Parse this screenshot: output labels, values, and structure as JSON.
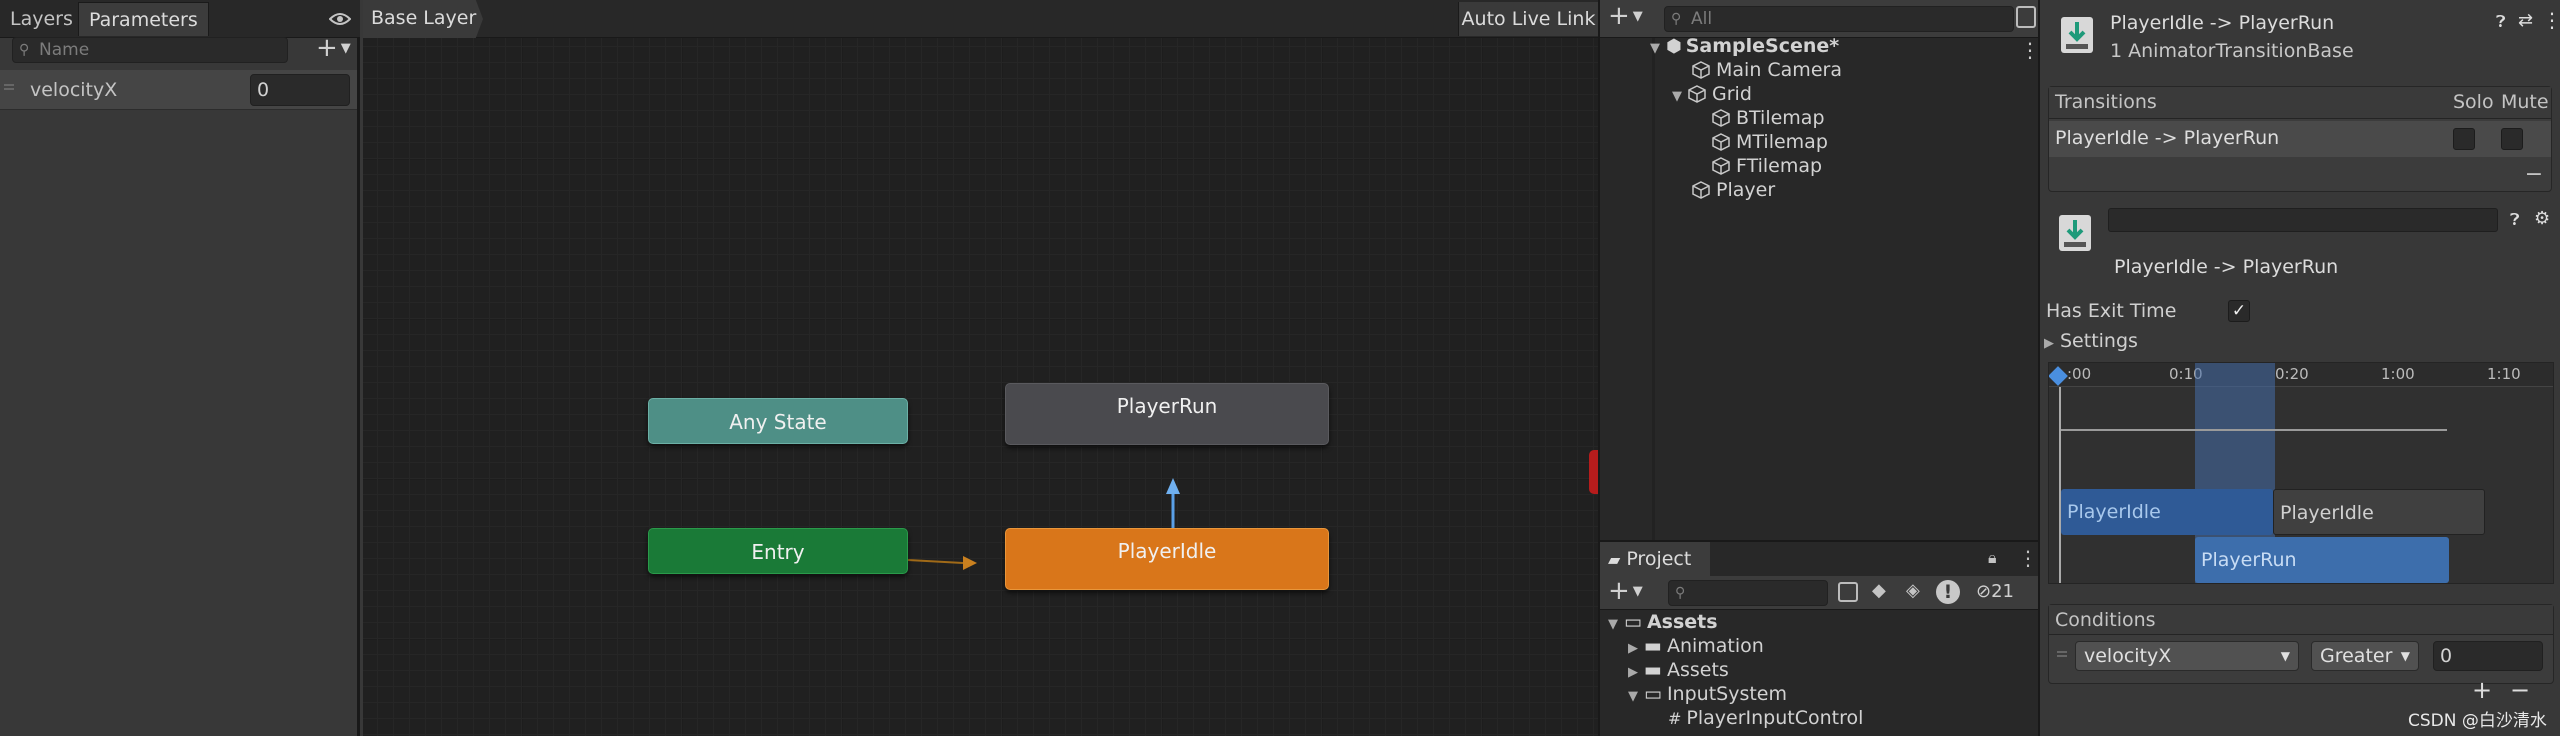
{
  "params": {
    "tabs": [
      "Layers",
      "Parameters"
    ],
    "search_placeholder": "Name",
    "add": "+",
    "items": [
      {
        "name": "velocityX",
        "value": "0"
      }
    ]
  },
  "graph": {
    "breadcrumb": "Base Layer",
    "auto_live_link": "Auto Live Link",
    "nodes": {
      "any_state": "Any State",
      "entry": "Entry",
      "player_run": "PlayerRun",
      "player_idle": "PlayerIdle"
    },
    "colors": {
      "any_state": "#4e8f86",
      "entry": "#1a7a37",
      "idle": "#d9761a",
      "run": "#4a4a4e"
    }
  },
  "hierarchy": {
    "search_placeholder": "All",
    "scene": "SampleScene*",
    "items": [
      {
        "label": "Main Camera"
      },
      {
        "label": "Grid"
      },
      {
        "label": "BTilemap"
      },
      {
        "label": "MTilemap"
      },
      {
        "label": "FTilemap"
      },
      {
        "label": "Player"
      }
    ]
  },
  "project": {
    "title": "Project",
    "hidden_count": "21",
    "tree": [
      {
        "label": "Assets"
      },
      {
        "label": "Animation"
      },
      {
        "label": "Assets"
      },
      {
        "label": "InputSystem"
      },
      {
        "label": "PlayerInputControl"
      }
    ]
  },
  "inspector": {
    "title": "PlayerIdle -> PlayerRun",
    "subtitle": "1 AnimatorTransitionBase",
    "transitions_header": "Transitions",
    "solo": "Solo",
    "mute": "Mute",
    "transition_row": "PlayerIdle -> PlayerRun",
    "minus": "−",
    "transition_label": "PlayerIdle -> PlayerRun",
    "has_exit_time": "Has Exit Time",
    "settings": "Settings",
    "timeline_ticks": [
      ":00",
      "0:10",
      "0:20",
      "1:00",
      "1:10"
    ],
    "timeline_bars": [
      "PlayerIdle",
      "PlayerIdle",
      "PlayerRun"
    ],
    "conditions_header": "Conditions",
    "condition": {
      "param": "velocityX",
      "op": "Greater",
      "value": "0"
    },
    "plus": "+"
  },
  "watermark": "CSDN @白沙清水"
}
